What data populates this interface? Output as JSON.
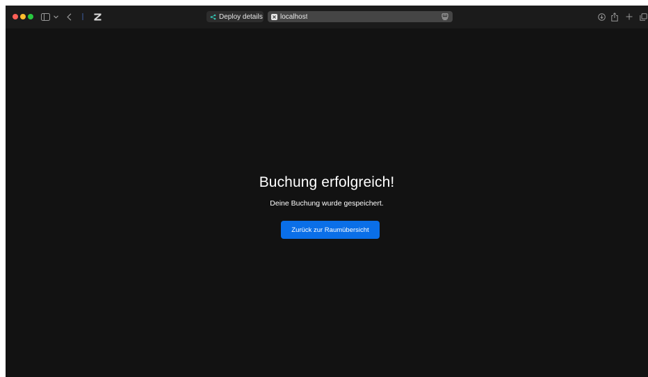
{
  "browser": {
    "tabs": [
      {
        "label": "Deploy details |...",
        "favicon": "netlify-icon",
        "active": false
      },
      {
        "label": "localhost",
        "favicon": "app-icon",
        "active": true
      }
    ],
    "toolbar_icons": [
      "sidebar-icon",
      "chevron-down-icon",
      "back-icon",
      "zed-icon",
      "download-icon",
      "share-icon",
      "plus-icon",
      "tabs-overview-icon"
    ]
  },
  "page": {
    "title": "Buchung erfolgreich!",
    "message": "Deine Buchung wurde gespeichert.",
    "button_label": "Zurück zur Raumübersicht"
  },
  "colors": {
    "background": "#121212",
    "toolbar": "#1b1b1b",
    "accent": "#0a6fe8",
    "traffic_red": "#ff5f57",
    "traffic_yellow": "#febc2e",
    "traffic_green": "#28c840"
  }
}
